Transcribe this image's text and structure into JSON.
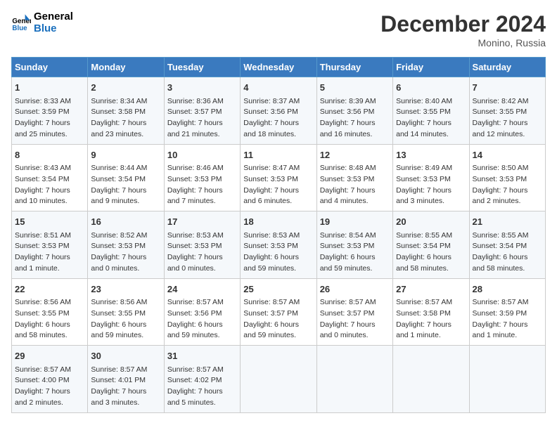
{
  "logo": {
    "text_general": "General",
    "text_blue": "Blue"
  },
  "header": {
    "title": "December 2024",
    "subtitle": "Monino, Russia"
  },
  "days_of_week": [
    "Sunday",
    "Monday",
    "Tuesday",
    "Wednesday",
    "Thursday",
    "Friday",
    "Saturday"
  ],
  "weeks": [
    [
      {
        "day": "1",
        "detail": "Sunrise: 8:33 AM\nSunset: 3:59 PM\nDaylight: 7 hours\nand 25 minutes."
      },
      {
        "day": "2",
        "detail": "Sunrise: 8:34 AM\nSunset: 3:58 PM\nDaylight: 7 hours\nand 23 minutes."
      },
      {
        "day": "3",
        "detail": "Sunrise: 8:36 AM\nSunset: 3:57 PM\nDaylight: 7 hours\nand 21 minutes."
      },
      {
        "day": "4",
        "detail": "Sunrise: 8:37 AM\nSunset: 3:56 PM\nDaylight: 7 hours\nand 18 minutes."
      },
      {
        "day": "5",
        "detail": "Sunrise: 8:39 AM\nSunset: 3:56 PM\nDaylight: 7 hours\nand 16 minutes."
      },
      {
        "day": "6",
        "detail": "Sunrise: 8:40 AM\nSunset: 3:55 PM\nDaylight: 7 hours\nand 14 minutes."
      },
      {
        "day": "7",
        "detail": "Sunrise: 8:42 AM\nSunset: 3:55 PM\nDaylight: 7 hours\nand 12 minutes."
      }
    ],
    [
      {
        "day": "8",
        "detail": "Sunrise: 8:43 AM\nSunset: 3:54 PM\nDaylight: 7 hours\nand 10 minutes."
      },
      {
        "day": "9",
        "detail": "Sunrise: 8:44 AM\nSunset: 3:54 PM\nDaylight: 7 hours\nand 9 minutes."
      },
      {
        "day": "10",
        "detail": "Sunrise: 8:46 AM\nSunset: 3:53 PM\nDaylight: 7 hours\nand 7 minutes."
      },
      {
        "day": "11",
        "detail": "Sunrise: 8:47 AM\nSunset: 3:53 PM\nDaylight: 7 hours\nand 6 minutes."
      },
      {
        "day": "12",
        "detail": "Sunrise: 8:48 AM\nSunset: 3:53 PM\nDaylight: 7 hours\nand 4 minutes."
      },
      {
        "day": "13",
        "detail": "Sunrise: 8:49 AM\nSunset: 3:53 PM\nDaylight: 7 hours\nand 3 minutes."
      },
      {
        "day": "14",
        "detail": "Sunrise: 8:50 AM\nSunset: 3:53 PM\nDaylight: 7 hours\nand 2 minutes."
      }
    ],
    [
      {
        "day": "15",
        "detail": "Sunrise: 8:51 AM\nSunset: 3:53 PM\nDaylight: 7 hours\nand 1 minute."
      },
      {
        "day": "16",
        "detail": "Sunrise: 8:52 AM\nSunset: 3:53 PM\nDaylight: 7 hours\nand 0 minutes."
      },
      {
        "day": "17",
        "detail": "Sunrise: 8:53 AM\nSunset: 3:53 PM\nDaylight: 7 hours\nand 0 minutes."
      },
      {
        "day": "18",
        "detail": "Sunrise: 8:53 AM\nSunset: 3:53 PM\nDaylight: 6 hours\nand 59 minutes."
      },
      {
        "day": "19",
        "detail": "Sunrise: 8:54 AM\nSunset: 3:53 PM\nDaylight: 6 hours\nand 59 minutes."
      },
      {
        "day": "20",
        "detail": "Sunrise: 8:55 AM\nSunset: 3:54 PM\nDaylight: 6 hours\nand 58 minutes."
      },
      {
        "day": "21",
        "detail": "Sunrise: 8:55 AM\nSunset: 3:54 PM\nDaylight: 6 hours\nand 58 minutes."
      }
    ],
    [
      {
        "day": "22",
        "detail": "Sunrise: 8:56 AM\nSunset: 3:55 PM\nDaylight: 6 hours\nand 58 minutes."
      },
      {
        "day": "23",
        "detail": "Sunrise: 8:56 AM\nSunset: 3:55 PM\nDaylight: 6 hours\nand 59 minutes."
      },
      {
        "day": "24",
        "detail": "Sunrise: 8:57 AM\nSunset: 3:56 PM\nDaylight: 6 hours\nand 59 minutes."
      },
      {
        "day": "25",
        "detail": "Sunrise: 8:57 AM\nSunset: 3:57 PM\nDaylight: 6 hours\nand 59 minutes."
      },
      {
        "day": "26",
        "detail": "Sunrise: 8:57 AM\nSunset: 3:57 PM\nDaylight: 7 hours\nand 0 minutes."
      },
      {
        "day": "27",
        "detail": "Sunrise: 8:57 AM\nSunset: 3:58 PM\nDaylight: 7 hours\nand 1 minute."
      },
      {
        "day": "28",
        "detail": "Sunrise: 8:57 AM\nSunset: 3:59 PM\nDaylight: 7 hours\nand 1 minute."
      }
    ],
    [
      {
        "day": "29",
        "detail": "Sunrise: 8:57 AM\nSunset: 4:00 PM\nDaylight: 7 hours\nand 2 minutes."
      },
      {
        "day": "30",
        "detail": "Sunrise: 8:57 AM\nSunset: 4:01 PM\nDaylight: 7 hours\nand 3 minutes."
      },
      {
        "day": "31",
        "detail": "Sunrise: 8:57 AM\nSunset: 4:02 PM\nDaylight: 7 hours\nand 5 minutes."
      },
      {
        "day": "",
        "detail": ""
      },
      {
        "day": "",
        "detail": ""
      },
      {
        "day": "",
        "detail": ""
      },
      {
        "day": "",
        "detail": ""
      }
    ]
  ]
}
